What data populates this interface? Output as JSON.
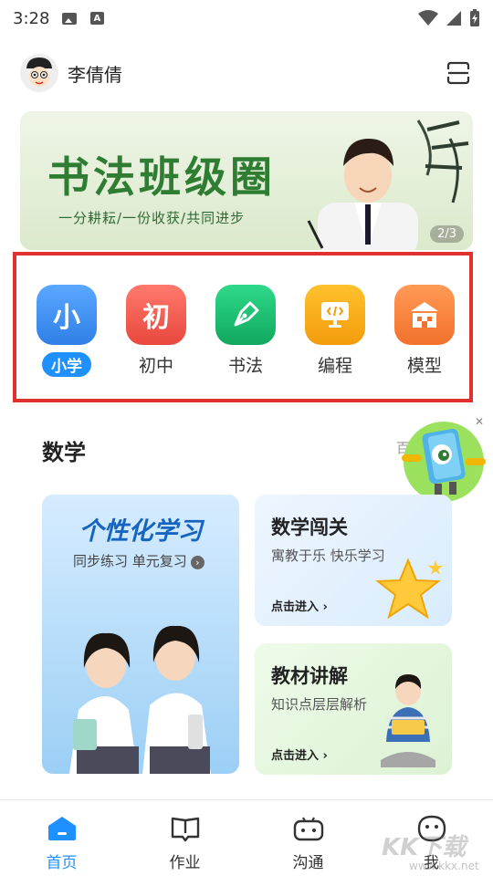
{
  "status_bar": {
    "time": "3:28"
  },
  "header": {
    "user_name": "李倩倩"
  },
  "banner": {
    "title": "书法班级圈",
    "subtitle": "一分耕耘/一份收获/共同进步",
    "page_indicator": "2/3"
  },
  "categories": [
    {
      "label": "小学",
      "icon_text": "小",
      "color": "#3b8ff5",
      "active": true
    },
    {
      "label": "初中",
      "icon_text": "初",
      "color": "#ef5a4f",
      "active": false
    },
    {
      "label": "书法",
      "icon_text": "",
      "color": "#16b86a",
      "active": false
    },
    {
      "label": "编程",
      "icon_text": "",
      "color": "#f7a90f",
      "active": false
    },
    {
      "label": "模型",
      "icon_text": "",
      "color": "#f47a3a",
      "active": false
    }
  ],
  "math": {
    "title": "数学",
    "more": "百",
    "big_card": {
      "title": "个性化学习",
      "subtitle": "同步练习 单元复习"
    },
    "cards": [
      {
        "title": "数学闯关",
        "subtitle": "寓教于乐 快乐学习",
        "enter": "点击进入 ›"
      },
      {
        "title": "教材讲解",
        "subtitle": "知识点层层解析",
        "enter": "点击进入 ›"
      }
    ]
  },
  "bottom_nav": [
    {
      "label": "首页",
      "active": true
    },
    {
      "label": "作业",
      "active": false
    },
    {
      "label": "沟通",
      "active": false
    },
    {
      "label": "我",
      "active": false
    }
  ],
  "watermark": {
    "text": "KK下载",
    "url": "www.kkx.net"
  },
  "colors": {
    "accent": "#1e90ff",
    "highlight_border": "#e03131",
    "banner_green": "#2e7d32"
  }
}
